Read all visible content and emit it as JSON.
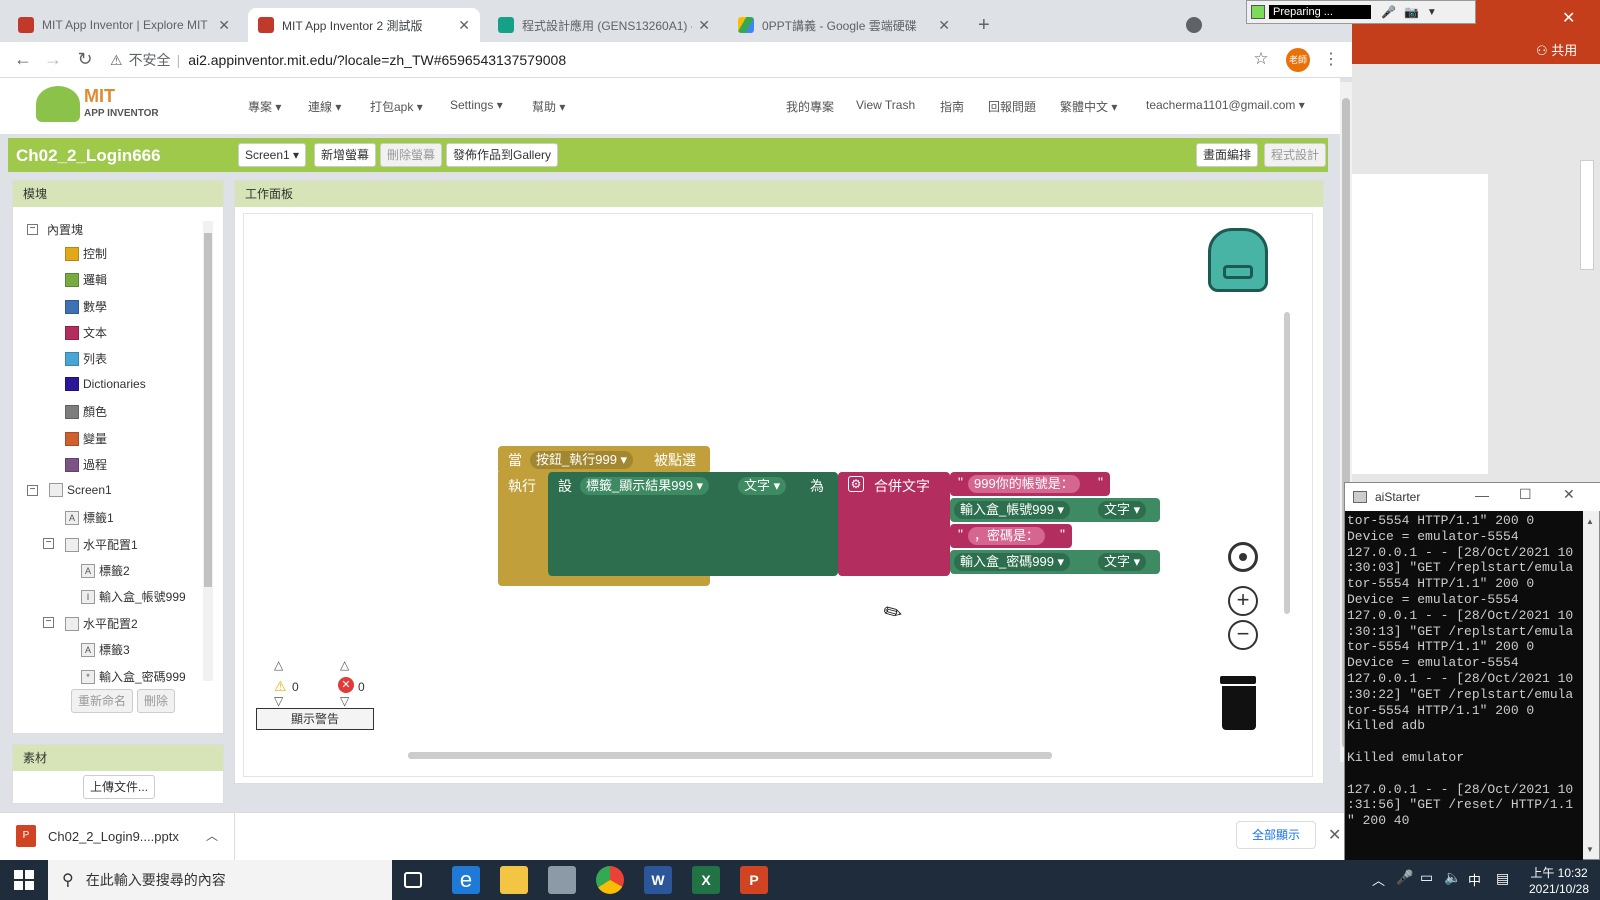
{
  "browser": {
    "tabs": [
      {
        "title": "MIT App Inventor | Explore MIT",
        "active": false
      },
      {
        "title": "MIT App Inventor 2 測試版",
        "active": true
      },
      {
        "title": "程式設計應用 (GENS13260A1) -",
        "active": false
      },
      {
        "title": "0PPT講義 - Google 雲端硬碟",
        "active": false
      }
    ],
    "new_tab": "+",
    "security": "不安全",
    "url": "ai2.appinventor.mit.edu/?locale=zh_TW#6596543137579008",
    "profile": "老師"
  },
  "recorder": {
    "status": "Preparing ..."
  },
  "share_label": "共用",
  "app": {
    "logo_top": "MIT",
    "logo_bottom": "APP INVENTOR",
    "menus": [
      "專案",
      "連線",
      "打包apk",
      "Settings",
      "幫助"
    ],
    "right_links": [
      "我的專案",
      "View Trash",
      "指南",
      "回報問題",
      "繁體中文",
      "teacherma1101@gmail.com"
    ],
    "project_name": "Ch02_2_Login666",
    "screen_select": "Screen1",
    "add_screen": "新增螢幕",
    "remove_screen": "刪除螢幕",
    "publish": "發佈作品到Gallery",
    "designer": "畫面編排",
    "blocks_editor": "程式設計"
  },
  "blocks_panel": {
    "title": "模塊",
    "builtin": "內置塊",
    "categories": [
      {
        "label": "控制",
        "color": "#e1a91a"
      },
      {
        "label": "邏輯",
        "color": "#77ab41"
      },
      {
        "label": "數學",
        "color": "#3f71b5"
      },
      {
        "label": "文本",
        "color": "#b32d5e"
      },
      {
        "label": "列表",
        "color": "#49a6d4"
      },
      {
        "label": "Dictionaries",
        "color": "#2d1799"
      },
      {
        "label": "顏色",
        "color": "#7d7d7d"
      },
      {
        "label": "變量",
        "color": "#d05f2d"
      },
      {
        "label": "過程",
        "color": "#7c5385"
      }
    ],
    "components": [
      {
        "label": "Screen1",
        "level": 0
      },
      {
        "label": "標籤1",
        "level": 1
      },
      {
        "label": "水平配置1",
        "level": 1
      },
      {
        "label": "標籤2",
        "level": 2
      },
      {
        "label": "輸入盒_帳號999",
        "level": 2
      },
      {
        "label": "水平配置2",
        "level": 1
      },
      {
        "label": "標籤3",
        "level": 2
      },
      {
        "label": "輸入盒_密碼999",
        "level": 2
      }
    ],
    "rename": "重新命名",
    "delete": "刪除"
  },
  "assets": {
    "title": "素材",
    "upload": "上傳文件..."
  },
  "workspace": {
    "title": "工作面板",
    "event_when": "當",
    "event_component": "按鈕_執行999",
    "event_name": "被點選",
    "do_label": "執行",
    "set_label": "設",
    "set_component": "標籤_顯示結果999",
    "set_property": "文字",
    "to_label": "為",
    "join_label": "合併文字",
    "text1": "999你的帳號是：",
    "input1": "輸入盒_帳號999",
    "input1_prop": "文字",
    "text2": "，密碼是：",
    "input2": "輸入盒_密碼999",
    "input2_prop": "文字",
    "warnings_count": "0",
    "errors_count": "0",
    "show_warnings": "顯示警告"
  },
  "download": {
    "file": "Ch02_2_Login9....pptx",
    "show_all": "全部顯示"
  },
  "aistarter": {
    "title": "aiStarter",
    "lines": [
      "tor-5554 HTTP/1.1\" 200 0",
      "Device = emulator-5554",
      "127.0.0.1 - - [28/Oct/2021 10",
      ":30:03] \"GET /replstart/emula",
      "tor-5554 HTTP/1.1\" 200 0",
      "Device = emulator-5554",
      "127.0.0.1 - - [28/Oct/2021 10",
      ":30:13] \"GET /replstart/emula",
      "tor-5554 HTTP/1.1\" 200 0",
      "Device = emulator-5554",
      "127.0.0.1 - - [28/Oct/2021 10",
      ":30:22] \"GET /replstart/emula",
      "tor-5554 HTTP/1.1\" 200 0",
      "Killed adb",
      "",
      "Killed emulator",
      "",
      "127.0.0.1 - - [28/Oct/2021 10",
      ":31:56] \"GET /reset/ HTTP/1.1",
      "\" 200 40"
    ]
  },
  "taskbar": {
    "search_placeholder": "在此輸入要搜尋的內容",
    "time": "上午 10:32",
    "date": "2021/10/28",
    "ime": "中"
  }
}
